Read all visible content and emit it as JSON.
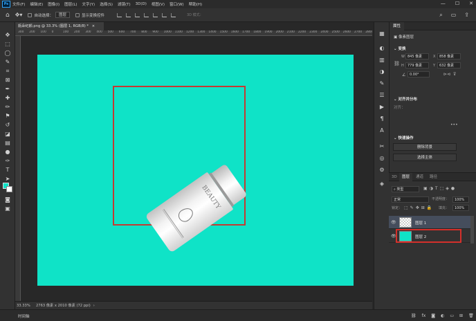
{
  "app": {
    "logo_text": "Ps"
  },
  "menu": {
    "items": [
      "文件(F)",
      "编辑(E)",
      "图像(I)",
      "图层(L)",
      "文字(Y)",
      "选择(S)",
      "滤镜(T)",
      "3D(D)",
      "视图(V)",
      "窗口(W)",
      "帮助(H)"
    ],
    "window_controls": [
      "—",
      "☐",
      "✕"
    ]
  },
  "options": {
    "auto_select_label": "自动选择：",
    "auto_select_value": "图层",
    "show_transform_label": "显示变换控件",
    "mode_3d_label": "3D 模式："
  },
  "document": {
    "tab_title": "瓶朵纪颜.png @ 33.3% (图层 1, RGB/8) *",
    "tab_close": "×",
    "canvas_color": "#0fe3c7",
    "product_brand": "BEAUTY"
  },
  "ruler": {
    "ticks": [
      "300",
      "200",
      "100",
      "0",
      "100",
      "200",
      "300",
      "400",
      "500",
      "600",
      "700",
      "800",
      "900",
      "1000",
      "1100",
      "1200",
      "1300",
      "1400",
      "1500",
      "1600",
      "1700",
      "1800",
      "1900",
      "2000",
      "2100",
      "2200",
      "2300",
      "2400",
      "2500",
      "2600",
      "2700",
      "2800"
    ]
  },
  "status": {
    "zoom": "33.33%",
    "doc_info": "2763 像素 x 2010 像素 (72 ppi)",
    "arrow": "›"
  },
  "timeline": {
    "label": "时间轴"
  },
  "properties": {
    "tab": "属性",
    "layer_type": "像素图层",
    "transform_title": "变换",
    "w_label": "W",
    "w_value": "845 像素",
    "h_label": "H",
    "h_value": "779 像素",
    "x_label": "X",
    "x_value": "858 像素",
    "y_label": "Y",
    "y_value": "632 像素",
    "angle_value": "0.00°",
    "align_title": "对齐并分布",
    "align_label": "对齐：",
    "quick_title": "快速操作",
    "remove_bg": "删除背景",
    "select_subject": "选择主体"
  },
  "layers": {
    "tabs": [
      "3D",
      "图层",
      "通道",
      "路径"
    ],
    "kind_label": "类型",
    "blend_mode": "正常",
    "opacity_label": "不透明度：",
    "opacity_value": "100%",
    "lock_label": "锁定：",
    "fill_label": "填充：",
    "fill_value": "100%",
    "items": [
      {
        "name": "图层 1"
      },
      {
        "name": "图层 2"
      }
    ]
  }
}
